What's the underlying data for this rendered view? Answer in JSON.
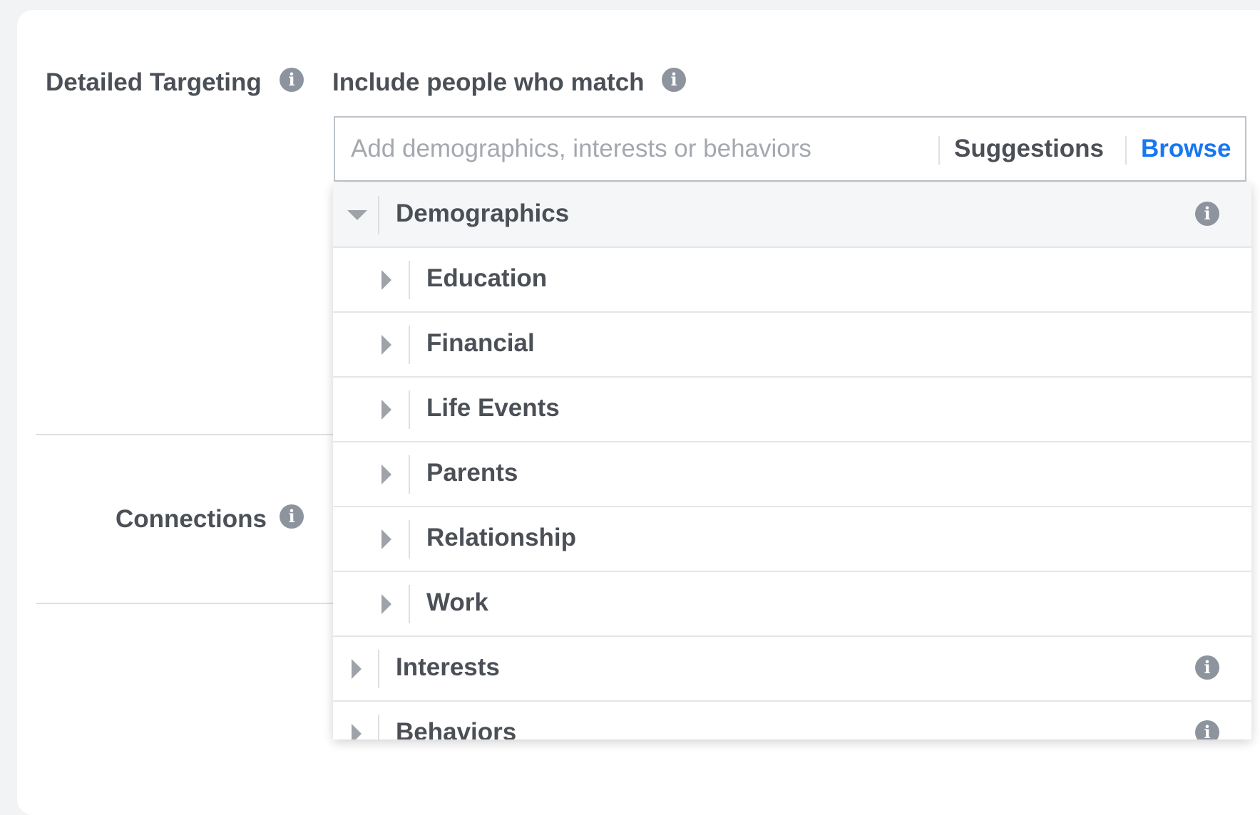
{
  "colors": {
    "label_text": "#4b4f56",
    "link_blue": "#1877f2",
    "placeholder": "#a4a8af",
    "info_icon": "#8d949e",
    "divider": "#dddfe2",
    "header_row_bg": "#f5f6f7"
  },
  "targeting": {
    "label": "Detailed Targeting",
    "info_icon": "info-icon"
  },
  "include": {
    "label": "Include people who match",
    "info_icon": "info-icon"
  },
  "search": {
    "placeholder": "Add demographics, interests or behaviors",
    "value": "",
    "suggestions_label": "Suggestions",
    "browse_label": "Browse"
  },
  "connections": {
    "label": "Connections",
    "info_icon": "info-icon"
  },
  "browse_tree": {
    "demographics": {
      "label": "Demographics",
      "expanded": true,
      "children": [
        "Education",
        "Financial",
        "Life Events",
        "Parents",
        "Relationship",
        "Work"
      ]
    },
    "interests": {
      "label": "Interests",
      "expanded": false
    },
    "behaviors": {
      "label": "Behaviors",
      "expanded": false
    }
  }
}
